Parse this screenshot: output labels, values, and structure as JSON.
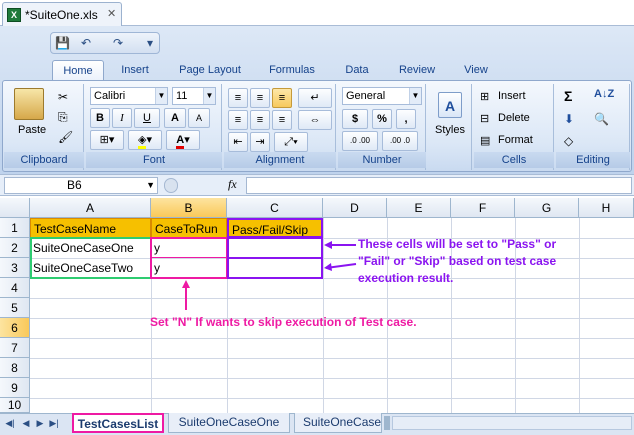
{
  "window": {
    "file_title": "*SuiteOne.xls",
    "close_glyph": "✕"
  },
  "qat": {
    "save": "💾",
    "undo": "↶",
    "redo": "↷",
    "more": "▾"
  },
  "tabs": [
    "Home",
    "Insert",
    "Page Layout",
    "Formulas",
    "Data",
    "Review",
    "View"
  ],
  "ribbon": {
    "clipboard": {
      "label": "Clipboard",
      "paste": "Paste"
    },
    "font": {
      "label": "Font",
      "family": "Calibri",
      "size": "11",
      "bold": "B",
      "italic": "I",
      "underline": "U",
      "grow": "A",
      "shrink": "A"
    },
    "alignment": {
      "label": "Alignment"
    },
    "number": {
      "label": "Number",
      "format": "General",
      "currency": "$",
      "percent": "%",
      "comma": ",",
      "inc": ".0 .00",
      "dec": ".00 .0"
    },
    "styles": {
      "label": "Styles"
    },
    "cells": {
      "label": "Cells",
      "insert": "Insert",
      "delete": "Delete",
      "format": "Format"
    },
    "editing": {
      "label": "Editing",
      "sum": "Σ"
    }
  },
  "formula_bar": {
    "name_box": "B6",
    "fx": "fx",
    "formula": ""
  },
  "grid": {
    "columns": [
      "A",
      "B",
      "C",
      "D",
      "E",
      "F",
      "G",
      "H"
    ],
    "rows": [
      "1",
      "2",
      "3",
      "4",
      "5",
      "6",
      "7",
      "8",
      "9",
      "10"
    ],
    "cells": {
      "A1": "TestCaseName",
      "B1": "CaseToRun",
      "C1": "Pass/Fail/Skip",
      "A2": "SuiteOneCaseOne",
      "B2": "y",
      "A3": "SuiteOneCaseTwo",
      "B3": "y"
    }
  },
  "sheets": [
    "TestCasesList",
    "SuiteOneCaseOne",
    "SuiteOneCaseT"
  ],
  "annotations": {
    "result_note": [
      "These cells will be set to \"Pass\" or",
      "\"Fail\" or \"Skip\" based on test case",
      "execution result."
    ],
    "skip_note": "Set \"N\" If wants to skip execution of Test case."
  },
  "colors": {
    "header_fill": "#f6c000",
    "annot_purple": "#8a14f0",
    "annot_magenta": "#ee1aa3",
    "green_border": "#2ecc71"
  }
}
